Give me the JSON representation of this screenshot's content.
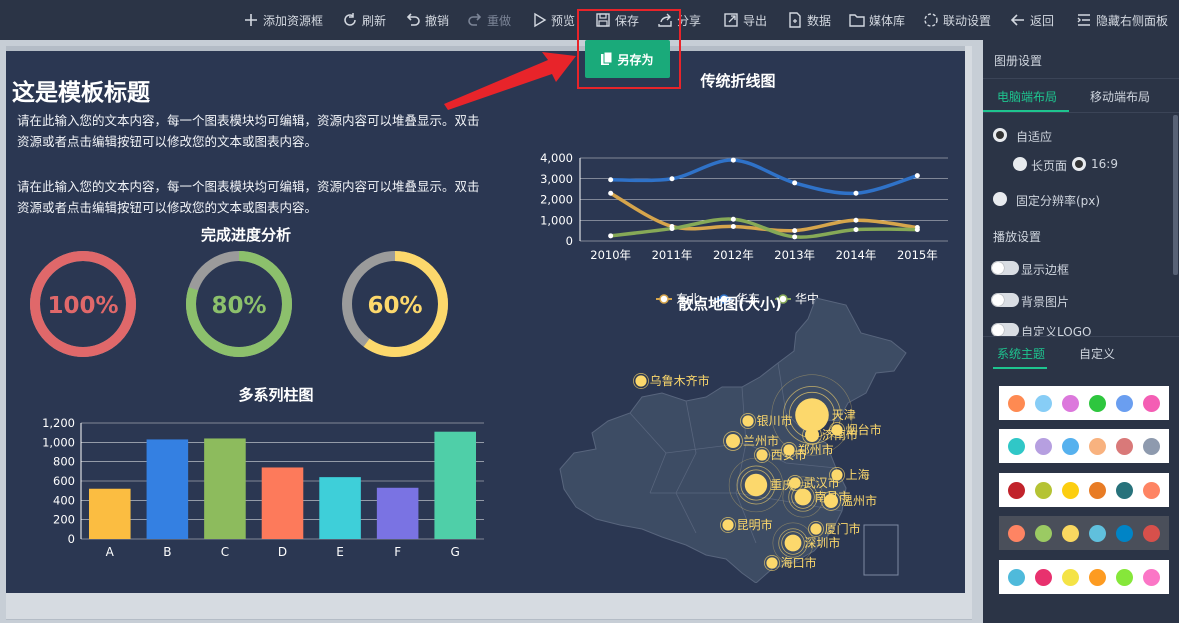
{
  "toolbar": {
    "items": [
      {
        "label": "添加资源框",
        "icon": "plus-icon",
        "enabled": true
      },
      {
        "label": "刷新",
        "icon": "refresh-icon",
        "enabled": true
      },
      {
        "label": "撤销",
        "icon": "undo-icon",
        "enabled": true
      },
      {
        "label": "重做",
        "icon": "redo-icon",
        "enabled": false
      },
      {
        "label": "预览",
        "icon": "play-icon",
        "enabled": true
      },
      {
        "label": "保存",
        "icon": "save-icon",
        "enabled": true
      },
      {
        "label": "分享",
        "icon": "share-icon",
        "enabled": true
      },
      {
        "label": "导出",
        "icon": "export-icon",
        "enabled": true
      },
      {
        "label": "数据",
        "icon": "data-icon",
        "enabled": true
      },
      {
        "label": "媒体库",
        "icon": "folder-icon",
        "enabled": true
      },
      {
        "label": "联动设置",
        "icon": "link-icon",
        "enabled": true
      },
      {
        "label": "返回",
        "icon": "back-arrow-icon",
        "enabled": true
      },
      {
        "label": "隐藏右侧面板",
        "icon": "panel-icon",
        "enabled": true
      }
    ],
    "save_as_label": "另存为",
    "save_as_icon": "copy-icon"
  },
  "slide": {
    "title": "这是模板标题",
    "paragraphs": [
      "请在此输入您的文本内容，每一个图表模块均可编辑，资源内容可以堆叠显示。双击资源或者点击编辑按钮可以修改您的文本或图表内容。",
      "请在此输入您的文本内容，每一个图表模块均可编辑，资源内容可以堆叠显示。双击资源或者点击编辑按钮可以修改您的文本或图表内容。"
    ],
    "colors": {
      "background": "#2b3752",
      "accent": "#1aaa7a",
      "highlight": "#e8242a"
    }
  },
  "chart_data": [
    {
      "type": "donut",
      "title": "完成进度分析",
      "items": [
        {
          "value": 100,
          "label": "100%",
          "color": "#e0686a"
        },
        {
          "value": 80,
          "label": "80%",
          "color": "#8cc06c"
        },
        {
          "value": 60,
          "label": "60%",
          "color": "#fcd86c"
        }
      ],
      "remainder_color": "#9b9b9b"
    },
    {
      "type": "bar",
      "title": "多系列柱图",
      "categories": [
        "A",
        "B",
        "C",
        "D",
        "E",
        "F",
        "G"
      ],
      "values": [
        520,
        1030,
        1040,
        740,
        640,
        530,
        1110
      ],
      "colors": [
        "#fbbd41",
        "#3480e2",
        "#8dbb5d",
        "#fd7a5b",
        "#3ecfd9",
        "#7a73e3",
        "#4fcfa8"
      ],
      "yticks": [
        "0",
        "200",
        "400",
        "600",
        "800",
        "1,000",
        "1,200"
      ],
      "ylim": [
        0,
        1200
      ]
    },
    {
      "type": "line",
      "title": "传统折线图",
      "categories": [
        "2010年",
        "2011年",
        "2012年",
        "2013年",
        "2014年",
        "2015年"
      ],
      "yticks": [
        "0",
        "1,000",
        "2,000",
        "3,000",
        "4,000"
      ],
      "ylim": [
        0,
        4000
      ],
      "series": [
        {
          "name": "东北",
          "color": "#d6a54c",
          "values": [
            2300,
            700,
            700,
            500,
            1000,
            650
          ]
        },
        {
          "name": "华东",
          "color": "#2f72c8",
          "values": [
            2950,
            3000,
            3900,
            2800,
            2300,
            3150
          ]
        },
        {
          "name": "华中",
          "color": "#86a957",
          "values": [
            250,
            600,
            1050,
            200,
            550,
            550
          ]
        }
      ],
      "legend_position": "bottom"
    },
    {
      "type": "scatter-map",
      "title": "散点地图(大小)",
      "cities": [
        {
          "name": "乌鲁木齐市",
          "size": 1
        },
        {
          "name": "银川市",
          "size": 1
        },
        {
          "name": "天津",
          "size": 5
        },
        {
          "name": "烟台市",
          "size": 1
        },
        {
          "name": "兰州市",
          "size": 1.5
        },
        {
          "name": "济南市",
          "size": 1.5
        },
        {
          "name": "西安市",
          "size": 1
        },
        {
          "name": "郑州市",
          "size": 1
        },
        {
          "name": "上海",
          "size": 1
        },
        {
          "name": "重庆",
          "size": 3
        },
        {
          "name": "武汉市",
          "size": 1
        },
        {
          "name": "南昌市",
          "size": 2
        },
        {
          "name": "温州市",
          "size": 1.5
        },
        {
          "name": "昆明市",
          "size": 1
        },
        {
          "name": "厦门市",
          "size": 1
        },
        {
          "name": "深圳市",
          "size": 2
        },
        {
          "name": "海口市",
          "size": 1
        }
      ],
      "point_color": "#fcd86c",
      "map_color": "#3d4c64"
    }
  ],
  "right_panel": {
    "section_title": "图册设置",
    "layout_tabs": [
      "电脑端布局",
      "移动端布局"
    ],
    "adaptive_label": "自适应",
    "long_page_label": "长页面",
    "ratio_label": "16:9",
    "fixed_label": "固定分辨率(px)",
    "playback_title": "播放设置",
    "toggles": [
      "显示边框",
      "背景图片",
      "自定义LOGO"
    ],
    "theme_tabs": [
      "系统主题",
      "自定义"
    ],
    "palettes": [
      [
        "#fe8a52",
        "#87cdf6",
        "#dc78dc",
        "#2ec63e",
        "#6a9ef0",
        "#f45eb4"
      ],
      [
        "#30c7c7",
        "#b69fe0",
        "#56b1ee",
        "#f8b27f",
        "#d97979",
        "#8e9aae"
      ],
      [
        "#c1232b",
        "#b5c334",
        "#fcce10",
        "#e87c25",
        "#27727b",
        "#fe8463"
      ],
      [
        "#fe8463",
        "#9bca63",
        "#fad860",
        "#60c0dd",
        "#0084c6",
        "#d7504b"
      ],
      [
        "#4fbadb",
        "#e8316e",
        "#f4e346",
        "#fd9b21",
        "#86e73a",
        "#fb76c6"
      ]
    ],
    "selected_palette": 3
  }
}
